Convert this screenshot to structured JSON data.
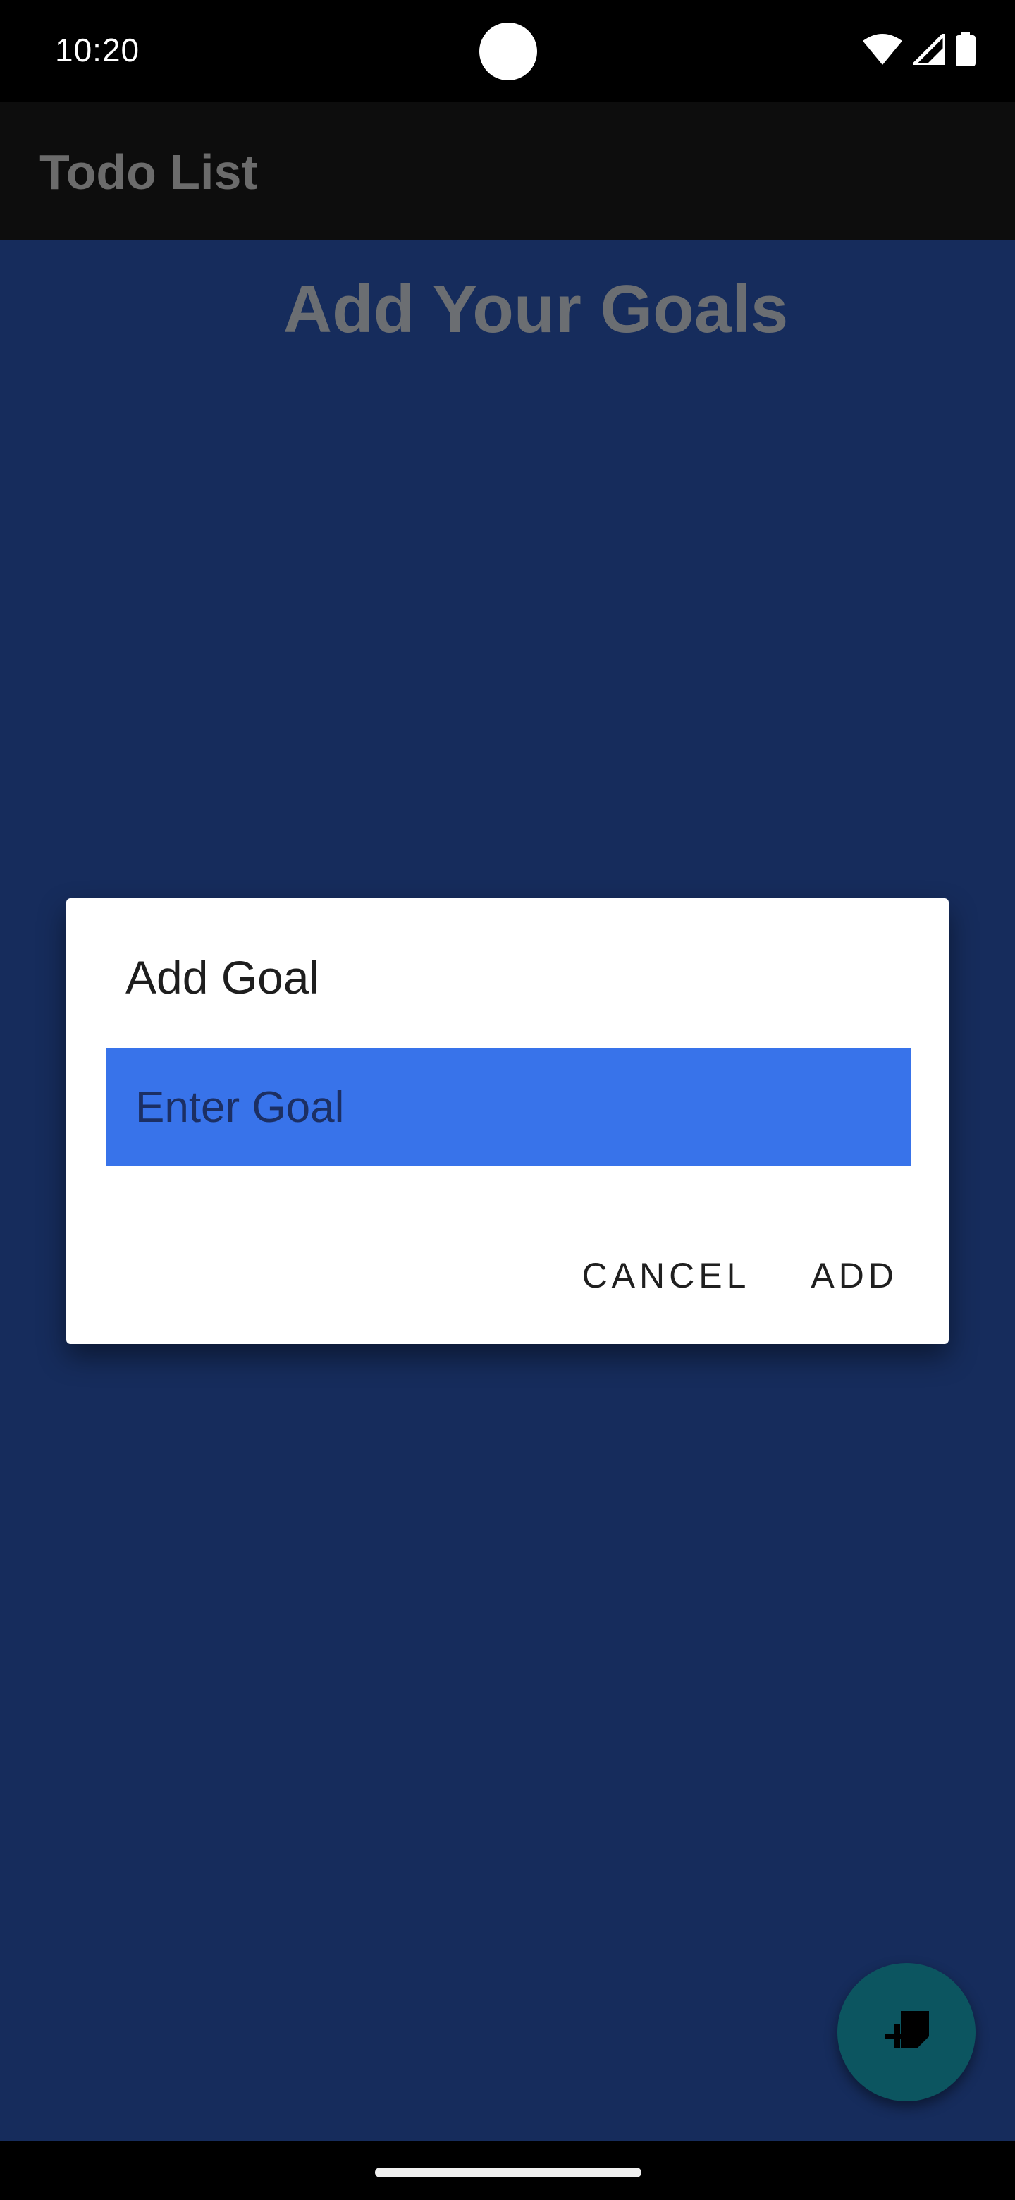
{
  "status_bar": {
    "time": "10:20",
    "icons": [
      "wifi-icon",
      "cellular-signal-icon",
      "battery-icon"
    ]
  },
  "app_bar": {
    "title": "Todo List"
  },
  "main": {
    "heading": "Add Your Goals"
  },
  "dialog": {
    "title": "Add Goal",
    "input": {
      "value": "",
      "placeholder": "Enter Goal"
    },
    "cancel_label": "CANCEL",
    "add_label": "ADD"
  },
  "fab": {
    "icon": "add-note-icon"
  },
  "colors": {
    "content_background": "#162c5c",
    "input_background": "#3873ea",
    "fab_background": "#0c5560"
  }
}
